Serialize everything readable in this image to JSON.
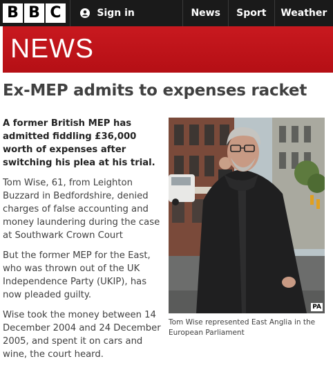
{
  "header": {
    "logo_letters": [
      "B",
      "B",
      "C"
    ],
    "signin_label": "Sign in",
    "nav": [
      {
        "label": "News"
      },
      {
        "label": "Sport"
      },
      {
        "label": "Weather"
      }
    ]
  },
  "banner": {
    "title": "NEWS",
    "color": "#bb1919"
  },
  "article": {
    "headline": "Ex-MEP admits to expenses racket",
    "paragraphs": [
      "A former British MEP has admitted fiddling £36,000 worth of expenses after switching his plea at his trial.",
      "Tom Wise, 61, from Leighton Buzzard in Bedfordshire, denied charges of false accounting and money laundering during the case at Southwark Crown Court",
      "But the former MEP for the East, who was thrown out of the UK Independence Party (UKIP), has now pleaded guilty.",
      "Wise took the money between 14 December 2004 and 24 December 2005, and spent it on cars and wine, the court heard."
    ],
    "image": {
      "credit": "PA",
      "caption": "Tom Wise represented East Anglia in the European Parliament"
    }
  }
}
